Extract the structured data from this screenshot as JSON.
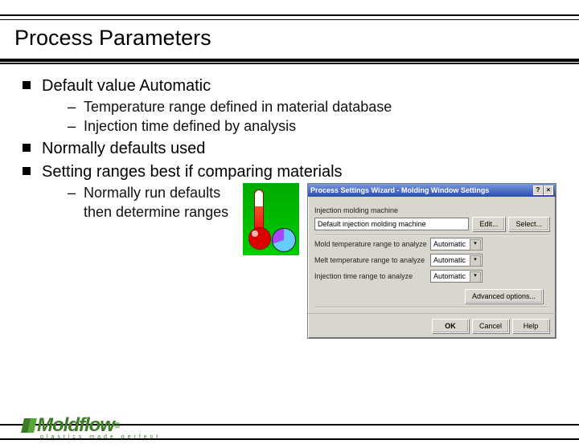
{
  "header": {
    "title": "Process Parameters"
  },
  "bullets": [
    {
      "text": "Default value Automatic",
      "subs": [
        "Temperature range defined in material database",
        "Injection time defined by analysis"
      ]
    },
    {
      "text": "Normally defaults used",
      "subs": []
    },
    {
      "text": "Setting ranges best if comparing materials",
      "subs": [
        "Normally run defaults then determine ranges"
      ]
    }
  ],
  "dialog": {
    "title": "Process Settings Wizard - Molding Window Settings",
    "help_btn": "?",
    "close_btn": "×",
    "machine_label": "Injection molding machine",
    "machine_value": "Default injection molding machine",
    "edit": "Edit...",
    "select": "Select...",
    "rows": [
      {
        "label": "Mold temperature range to analyze",
        "value": "Automatic"
      },
      {
        "label": "Melt temperature range to analyze",
        "value": "Automatic"
      },
      {
        "label": "Injection time range to analyze",
        "value": "Automatic"
      }
    ],
    "adv": "Advanced options...",
    "ok": "OK",
    "cancel": "Cancel",
    "helpb": "Help"
  },
  "footer": {
    "brand": "Moldflow",
    "tagline": "plastics made perfect",
    "reg": "®"
  }
}
